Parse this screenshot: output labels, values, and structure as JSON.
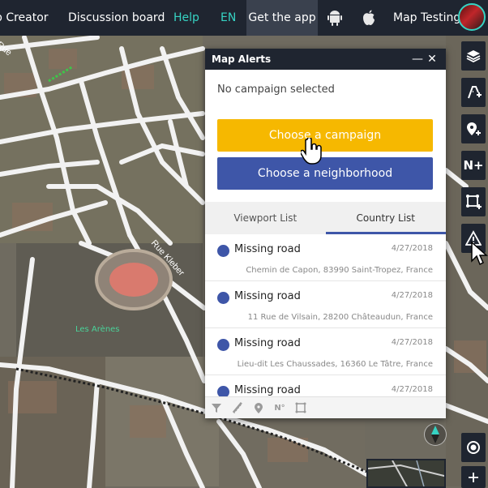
{
  "nav": {
    "creator": "p Creator",
    "discussion": "Discussion board",
    "help": "Help",
    "language": "EN",
    "get_app": "Get the app",
    "user": "Map Testing"
  },
  "map": {
    "street_rue": "Rue",
    "street_kleber": "Rue Kleber",
    "poi_arenes": "Les Arènes"
  },
  "panel": {
    "title": "Map Alerts",
    "minimize": "—",
    "close": "✕",
    "status": "No campaign selected",
    "choose_campaign": "Choose a campaign",
    "choose_neighborhood": "Choose a neighborhood",
    "tabs": [
      "Viewport List",
      "Country List"
    ],
    "active_tab": "Country List",
    "alerts": [
      {
        "title": "Missing road",
        "date": "4/27/2018",
        "address": "Chemin de Capon, 83990 Saint-Tropez, France"
      },
      {
        "title": "Missing road",
        "date": "4/27/2018",
        "address": "11 Rue de Vilsain, 28200 Châteaudun, France"
      },
      {
        "title": "Missing road",
        "date": "4/27/2018",
        "address": "Lieu-dit Les Chaussades, 16360 Le Tâtre, France"
      },
      {
        "title": "Missing road",
        "date": "4/27/2018",
        "address": ""
      }
    ],
    "filters": [
      "filter-icon",
      "road-icon",
      "place-icon",
      "N°",
      "area-icon"
    ]
  },
  "toolbar": {
    "items": [
      "layers-icon",
      "road-add-icon",
      "place-add-icon",
      "N+",
      "area-add-icon",
      "alert-icon",
      "locate-icon",
      "zoom-in-icon"
    ]
  },
  "colors": {
    "topbar": "#1f2530",
    "accent_teal": "#36d3c3",
    "campaign_yellow": "#f6b800",
    "neighborhood_blue": "#3e56a8"
  }
}
